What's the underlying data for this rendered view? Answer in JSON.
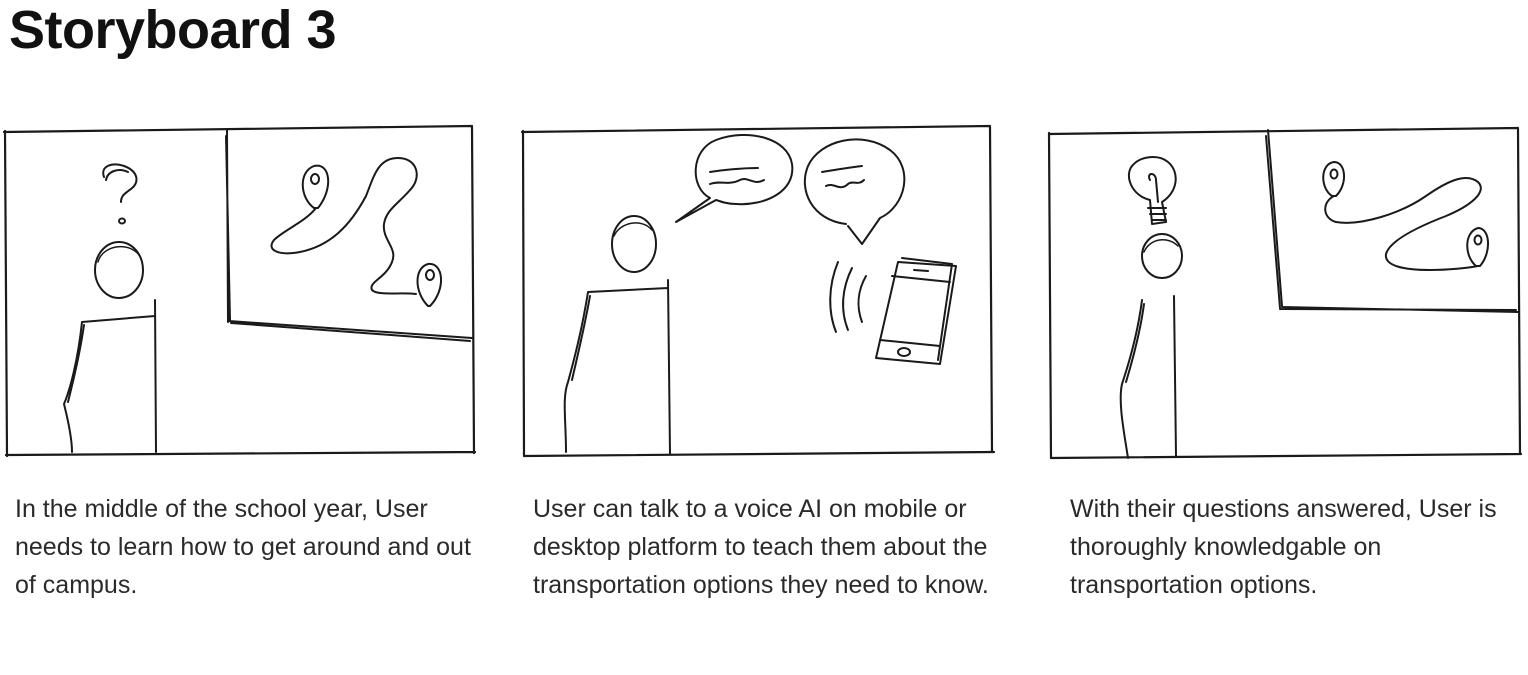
{
  "title": "Storyboard 3",
  "panels": [
    {
      "caption": "In the middle of the school year, User needs to learn how to get around and out of campus."
    },
    {
      "caption": "User can talk to a voice AI on mobile or desktop platform to teach them about the transportation options they need to know."
    },
    {
      "caption": "With their questions answered, User is thoroughly knowledgable on transportation options."
    }
  ],
  "icons": {
    "question": "question-mark-icon",
    "map_pin": "map-pin-icon",
    "speech_bubble": "speech-bubble-icon",
    "phone": "smartphone-icon",
    "lightbulb": "lightbulb-icon"
  },
  "colors": {
    "ink": "#1a1a1a",
    "text": "#2a2a2a",
    "background": "#ffffff"
  }
}
